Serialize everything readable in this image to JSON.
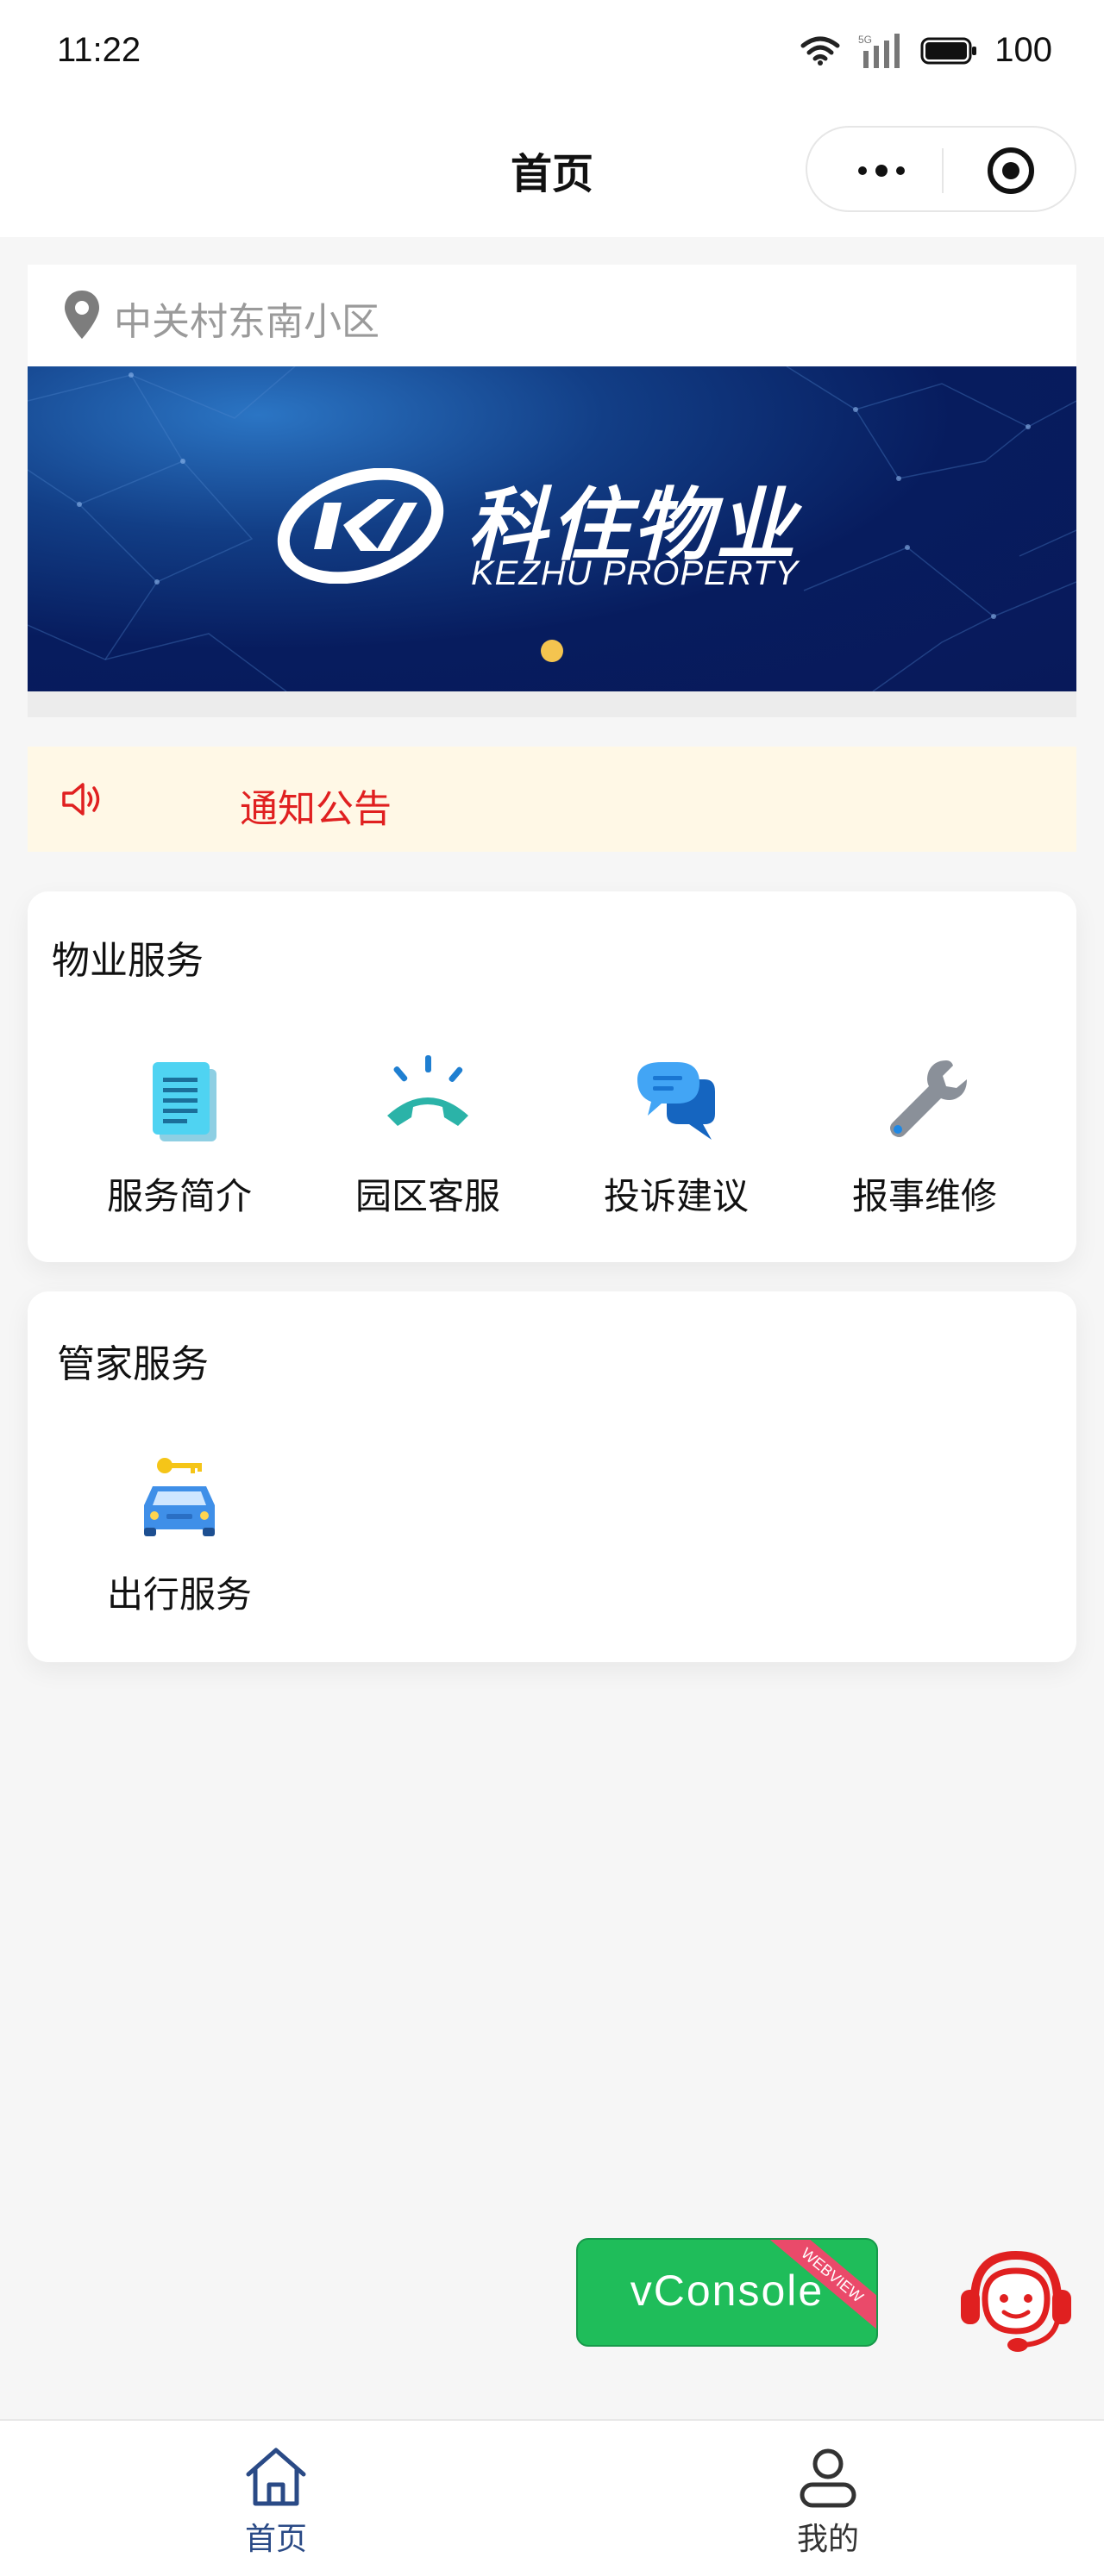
{
  "status_bar": {
    "time": "11:22",
    "battery": "100",
    "signal_label": "5G",
    "icons": [
      "wifi-icon",
      "signal-icon",
      "battery-icon"
    ]
  },
  "nav": {
    "title": "首页",
    "capsule_icons": [
      "more-icon",
      "target-icon"
    ]
  },
  "location": {
    "text": "中关村东南小区",
    "icon": "location-pin-icon"
  },
  "banner": {
    "brand_cn": "科住物业",
    "brand_en": "KEZHU PROPERTY",
    "page_indicator": {
      "current": 1,
      "total": 1
    }
  },
  "notice": {
    "text": "通知公告",
    "icon": "speaker-icon"
  },
  "property_services": {
    "title": "物业服务",
    "items": [
      {
        "label": "服务简介",
        "icon": "document-icon"
      },
      {
        "label": "园区客服",
        "icon": "phone-icon"
      },
      {
        "label": "投诉建议",
        "icon": "chat-icon"
      },
      {
        "label": "报事维修",
        "icon": "wrench-icon"
      }
    ]
  },
  "butler_services": {
    "title": "管家服务",
    "items": [
      {
        "label": "出行服务",
        "icon": "car-key-icon"
      }
    ]
  },
  "vconsole": {
    "label": "vConsole",
    "ribbon": "WEBVIEW"
  },
  "tabbar": {
    "tabs": [
      {
        "label": "首页",
        "icon": "home-icon",
        "active": true
      },
      {
        "label": "我的",
        "icon": "user-icon",
        "active": false
      }
    ]
  },
  "colors": {
    "notice_text": "#e02020",
    "notice_bg": "#fff8e6",
    "active_tab": "#2a4a86",
    "vconsole_green": "#1fbd5a",
    "banner_dot": "#f4c44f"
  }
}
